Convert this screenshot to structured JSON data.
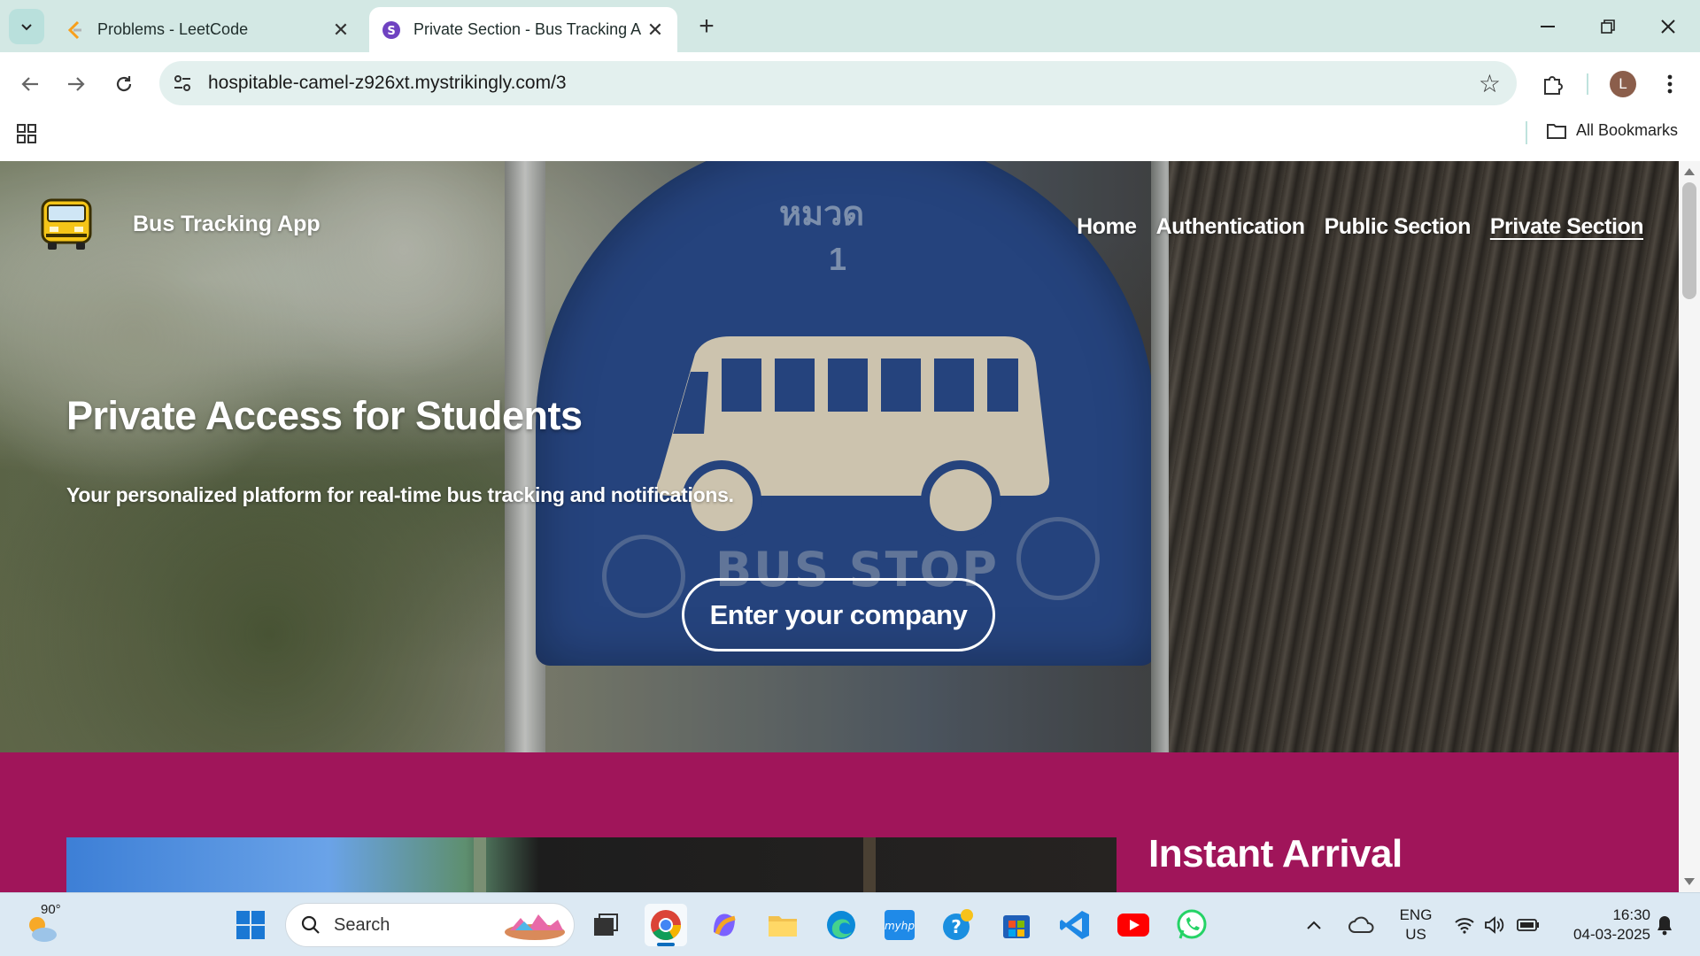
{
  "browser": {
    "tabs": [
      {
        "title": "Problems - LeetCode",
        "active": false
      },
      {
        "title": "Private Section - Bus Tracking A",
        "active": true
      }
    ],
    "url": "hospitable-camel-z926xt.mystrikingly.com/3",
    "profile_initial": "L",
    "all_bookmarks_label": "All Bookmarks"
  },
  "site": {
    "brand": "Bus Tracking App",
    "nav": [
      "Home",
      "Authentication",
      "Public Section",
      "Private Section"
    ],
    "current_nav": "Private Section",
    "hero": {
      "title": "Private Access for Students",
      "subtitle": "Your personalized platform for real-time bus tracking and notifications.",
      "cta": "Enter your company",
      "sign_text": "BUS STOP",
      "sign_number": "1",
      "sign_top_text": "หมวด"
    },
    "section2": {
      "title": "Instant Arrival"
    }
  },
  "taskbar": {
    "weather_temp": "90°",
    "search_placeholder": "Search",
    "language": "ENG",
    "region": "US",
    "time": "16:30",
    "date": "04-03-2025"
  },
  "colors": {
    "tabstrip": "#d3e8e4",
    "omnibox": "#e3f0ee",
    "section2_bg": "#a0155a",
    "taskbar": "#dce9f3"
  }
}
